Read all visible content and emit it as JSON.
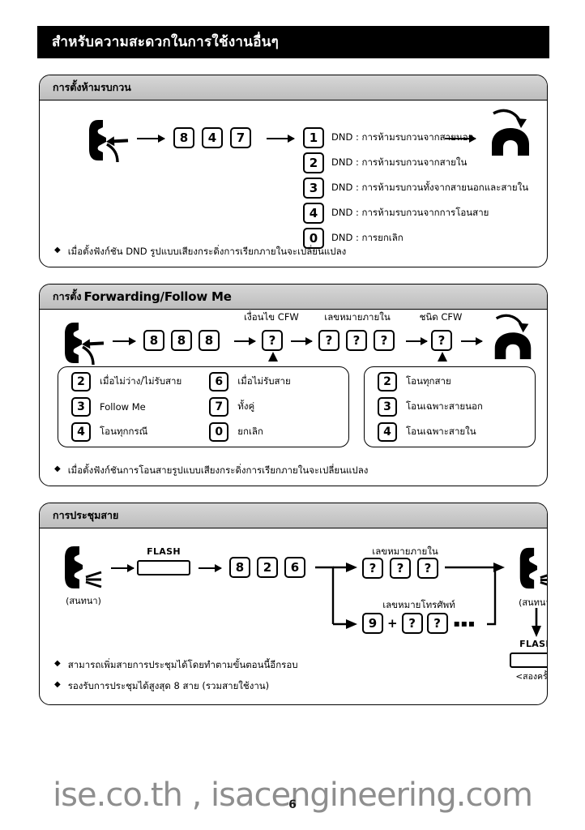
{
  "header": {
    "title": "สำหรับความสะดวกในการใช้งานอื่นๆ"
  },
  "sections": [
    {
      "title": "การตั้งห้ามรบกวน",
      "keys": [
        "8",
        "4",
        "7"
      ],
      "options": [
        {
          "key": "1",
          "text": "DND : การห้ามรบกวนจากสายนอก"
        },
        {
          "key": "2",
          "text": "DND : การห้ามรบกวนจากสายใน"
        },
        {
          "key": "3",
          "text": "DND : การห้ามรบกวนทั้งจากสายนอกและสายใน"
        },
        {
          "key": "4",
          "text": "DND : การห้ามรบกวนจากการโอนสาย"
        },
        {
          "key": "0",
          "text": "DND : การยกเลิก"
        }
      ],
      "note": "เมื่อตั้งฟังก์ชัน DND รูปแบบเสียงกระดิ่งการเรียกภายในจะเปลี่ยนแปลง",
      "note_bullet": "◆"
    },
    {
      "title_thai": "การตั้ง",
      "title_latin": "Forwarding/Follow Me",
      "keys": [
        "8",
        "8",
        "8"
      ],
      "flow_labels": {
        "condition": "เงื่อนไข CFW",
        "extension": "เลขหมายภายใน",
        "type": "ชนิด CFW"
      },
      "placeholder": "?",
      "left_box": {
        "col1": [
          {
            "key": "2",
            "text": "เมื่อไม่ว่าง/ไม่รับสาย"
          },
          {
            "key": "3",
            "text": "Follow Me"
          },
          {
            "key": "4",
            "text": "โอนทุกกรณี"
          }
        ],
        "col2": [
          {
            "key": "6",
            "text": "เมื่อไม่รับสาย"
          },
          {
            "key": "7",
            "text": "ทั้งคู่"
          },
          {
            "key": "0",
            "text": "ยกเลิก"
          }
        ]
      },
      "right_box": [
        {
          "key": "2",
          "text": "โอนทุกสาย"
        },
        {
          "key": "3",
          "text": "โอนเฉพาะสายนอก"
        },
        {
          "key": "4",
          "text": "โอนเฉพาะสายใน"
        }
      ],
      "note": "เมื่อตั้งฟังก์ชันการโอนสายรูปแบบเสียงกระดิ่งการเรียกภายในจะเปลี่ยนแปลง",
      "note_bullet": "◆"
    },
    {
      "title": "การประชุมสาย",
      "flash_label": "FLASH",
      "talk_caption": "(สนทนา)",
      "keys": [
        "8",
        "2",
        "6"
      ],
      "branch_labels": {
        "internal": "เลขหมายภายใน",
        "external": "เลขหมายโทรศัพท์"
      },
      "placeholder": "?",
      "external_prefix": "9",
      "plus_sign": "+",
      "ellipsis": "▪▪▪",
      "end_talk_caption": "(สนทนา)",
      "end_flash_label": "FLASH",
      "end_flash_caption": "<สองครั้ง>",
      "notes": [
        "สามารถเพิ่มสายการประชุมได้โดยทำตามขั้นตอนนี้อีกรอบ",
        "รองรับการประชุมได้สูงสุด 8 สาย (รวมสายใช้งาน)"
      ],
      "note_bullet": "◆"
    }
  ],
  "footer": {
    "watermark": "ise.co.th , isacengineering.com",
    "page_number": "6"
  },
  "icons": {
    "handset_offhook": "handset-offhook-icon",
    "handset_onhook": "handset-onhook-icon",
    "handset_talk": "handset-talking-icon"
  },
  "colors": {
    "header_bg": "#000000",
    "header_text": "#ffffff",
    "card_title_bg": "#cccccc",
    "watermark": "#8e8e8e"
  }
}
